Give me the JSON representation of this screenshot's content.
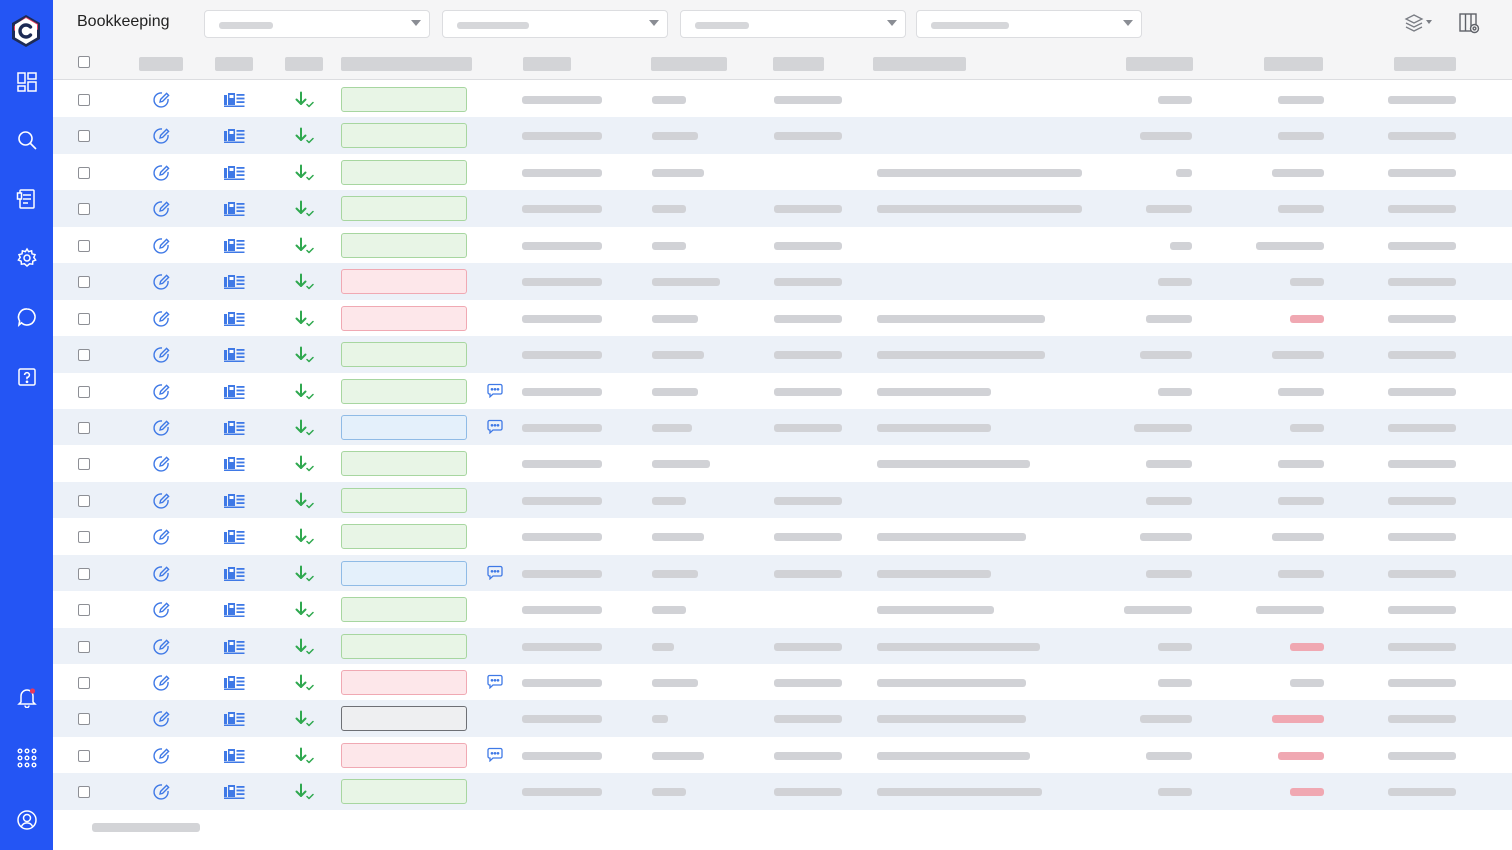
{
  "app": {
    "title": "Bookkeeping"
  },
  "colors": {
    "sidebar": "#2455f4",
    "status_green": {
      "fill": "#e8f5e6",
      "border": "#a7d6a0"
    },
    "status_red": {
      "fill": "#fde7ea",
      "border": "#f0a9b3"
    },
    "status_blue": {
      "fill": "#e4f0fb",
      "border": "#8fbbe6"
    },
    "status_gray": {
      "fill": "#eeeff1",
      "border": "#6e7075"
    },
    "icon_blue": "#3f79e6",
    "icon_green": "#2fa84f",
    "placeholder": "#d1d2d6",
    "negative": "#f0a8b2"
  },
  "sidebar": {
    "logo": "c-logo",
    "items": [
      {
        "icon": "dashboard-icon"
      },
      {
        "icon": "search-icon"
      },
      {
        "icon": "documents-icon"
      },
      {
        "icon": "gear-icon"
      },
      {
        "icon": "chat-icon"
      },
      {
        "icon": "help-icon"
      }
    ],
    "bottom_items": [
      {
        "icon": "bell-icon",
        "has_badge": true
      },
      {
        "icon": "apps-grid-icon"
      },
      {
        "icon": "user-account-icon"
      }
    ]
  },
  "toolbar": {
    "filters": [
      {
        "name": "filter-1",
        "value": ""
      },
      {
        "name": "filter-2",
        "value": ""
      },
      {
        "name": "filter-3",
        "value": ""
      },
      {
        "name": "filter-4",
        "value": ""
      }
    ],
    "icons": [
      "layers-menu-icon",
      "column-settings-icon"
    ]
  },
  "table": {
    "rows": [
      {
        "status": "green",
        "comment": false,
        "negative": false
      },
      {
        "status": "green",
        "comment": false,
        "negative": false
      },
      {
        "status": "green",
        "comment": false,
        "negative": false
      },
      {
        "status": "green",
        "comment": false,
        "negative": false
      },
      {
        "status": "green",
        "comment": false,
        "negative": false
      },
      {
        "status": "red",
        "comment": false,
        "negative": false
      },
      {
        "status": "red",
        "comment": false,
        "negative": true
      },
      {
        "status": "green",
        "comment": false,
        "negative": false
      },
      {
        "status": "green",
        "comment": true,
        "negative": false
      },
      {
        "status": "blue",
        "comment": true,
        "negative": false
      },
      {
        "status": "green",
        "comment": false,
        "negative": false
      },
      {
        "status": "green",
        "comment": false,
        "negative": false
      },
      {
        "status": "green",
        "comment": false,
        "negative": false
      },
      {
        "status": "blue",
        "comment": true,
        "negative": false
      },
      {
        "status": "green",
        "comment": false,
        "negative": false
      },
      {
        "status": "green",
        "comment": false,
        "negative": true
      },
      {
        "status": "red",
        "comment": true,
        "negative": false
      },
      {
        "status": "gray",
        "comment": false,
        "negative": true
      },
      {
        "status": "red",
        "comment": true,
        "negative": true
      },
      {
        "status": "green",
        "comment": false,
        "negative": true
      }
    ]
  }
}
